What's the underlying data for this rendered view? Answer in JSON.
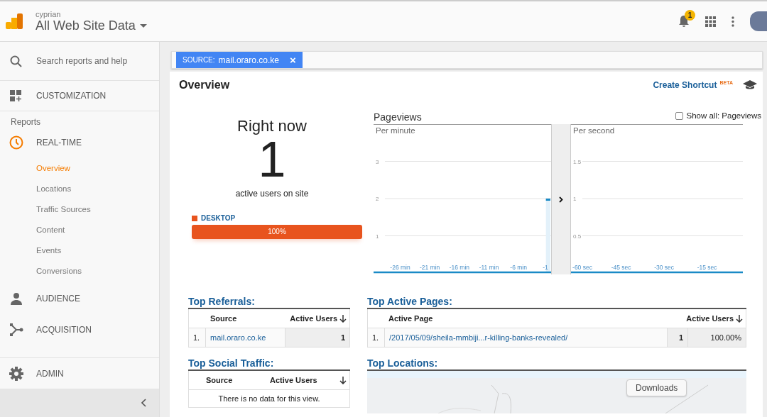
{
  "header": {
    "account": "cyprian",
    "property": "All Web Site Data",
    "notification_count": "1"
  },
  "sidebar": {
    "search_placeholder": "Search reports and help",
    "customization": "CUSTOMIZATION",
    "reports_label": "Reports",
    "sections": [
      {
        "kind": "realtime",
        "label": "REAL-TIME",
        "children": [
          {
            "label": "Overview",
            "selected": true
          },
          {
            "label": "Locations",
            "selected": false
          },
          {
            "label": "Traffic Sources",
            "selected": false
          },
          {
            "label": "Content",
            "selected": false
          },
          {
            "label": "Events",
            "selected": false
          },
          {
            "label": "Conversions",
            "selected": false
          }
        ]
      },
      {
        "kind": "audience",
        "label": "AUDIENCE"
      },
      {
        "kind": "acquisition",
        "label": "ACQUISITION"
      }
    ],
    "admin": "ADMIN"
  },
  "filter": {
    "key": "SOURCE:",
    "value": "mail.oraro.co.ke",
    "close": "×"
  },
  "title": "Overview",
  "shortcut": {
    "label": "Create Shortcut",
    "badge": "BETA"
  },
  "right_now": {
    "title": "Right now",
    "count": "1",
    "caption": "active users on site",
    "devices": [
      {
        "label": "DESKTOP",
        "color": "#e8541e",
        "level": 1,
        "reading": "100%"
      }
    ]
  },
  "pageviews": {
    "title": "Pageviews",
    "show_all": {
      "label": "Show all: Pageviews",
      "checked": false
    },
    "panels": [
      {
        "title": "Per minute",
        "chart_data": {
          "type": "bar",
          "x": [
            -30,
            -29,
            -28,
            -27,
            -26,
            -25,
            -24,
            -23,
            -22,
            -21,
            -20,
            -19,
            -18,
            -17,
            -16,
            -15,
            -14,
            -13,
            -12,
            -11,
            -10,
            -9,
            -8,
            -7,
            -6,
            -5,
            -4,
            -3,
            -2,
            -1
          ],
          "values": [
            0,
            0,
            0,
            0,
            0,
            0,
            0,
            0,
            0,
            0,
            0,
            0,
            0,
            0,
            0,
            0,
            0,
            0,
            0,
            0,
            0,
            0,
            0,
            0,
            0,
            0,
            0,
            0,
            0,
            2
          ],
          "grid": true,
          "xlim": [
            -30.5,
            -0.5
          ],
          "ylim": [
            0,
            4
          ],
          "yticks": [
            1,
            2,
            3
          ],
          "xticks": [
            {
              "value": -26,
              "label": "-26 min"
            },
            {
              "value": -21,
              "label": "-21 min"
            },
            {
              "value": -16,
              "label": "-16 min"
            },
            {
              "value": -11,
              "label": "-11 min"
            },
            {
              "value": -6,
              "label": "-6 min"
            },
            {
              "value": -1,
              "label": "-1"
            }
          ]
        }
      },
      {
        "title": "Per second",
        "chart_data": {
          "type": "bar",
          "x": [
            -60,
            -55,
            -50,
            -45,
            -40,
            -35,
            -30,
            -25,
            -20,
            -15,
            -10,
            -5
          ],
          "values": [
            0,
            0,
            0,
            0,
            0,
            0,
            0,
            0,
            0,
            0,
            0,
            0
          ],
          "grid": true,
          "xlim": [
            -62.5,
            -2.5
          ],
          "ylim": [
            0,
            2
          ],
          "yticks": [
            0.5,
            1,
            1.5
          ],
          "xticks": [
            {
              "value": -60,
              "label": "-60 sec"
            },
            {
              "value": -45,
              "label": "-45 sec"
            },
            {
              "value": -30,
              "label": "-30 sec"
            },
            {
              "value": -15,
              "label": "-15 sec"
            }
          ]
        }
      }
    ]
  },
  "top_referrals": {
    "title": "Top Referrals:",
    "columns": [
      "Source",
      "Active Users"
    ],
    "rows": [
      {
        "rank": "1.",
        "source": "mail.oraro.co.ke",
        "users": "1"
      }
    ]
  },
  "top_social": {
    "title": "Top Social Traffic:",
    "columns": [
      "Source",
      "Active Users"
    ],
    "empty": "There is no data for this view."
  },
  "top_pages": {
    "title": "Top Active Pages:",
    "columns": [
      "Active Page",
      "Active Users"
    ],
    "rows": [
      {
        "rank": "1.",
        "page": "/2017/05/09/sheila-mmbiji...r-killing-banks-revealed/",
        "users": "1",
        "percent": "100.00%"
      }
    ]
  },
  "top_locations": {
    "title": "Top Locations:",
    "tooltip": "Downloads"
  }
}
